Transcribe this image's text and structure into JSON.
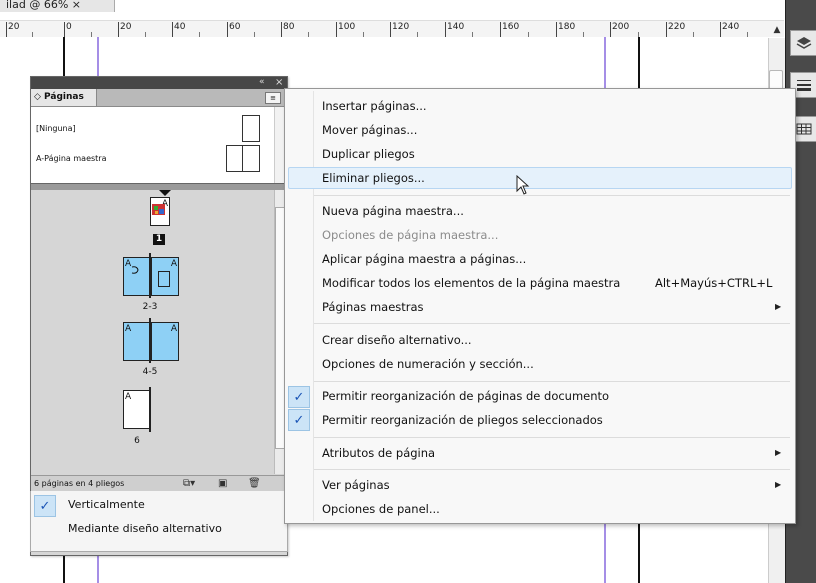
{
  "doc_tab": {
    "title": "ilad @ 66% ×"
  },
  "ruler": {
    "labels": [
      "20",
      "0",
      "20",
      "40",
      "60",
      "80",
      "100",
      "120",
      "140",
      "160",
      "180",
      "200",
      "220",
      "240"
    ]
  },
  "pages_panel": {
    "tab_label": "◇ Páginas",
    "collapse_glyph": "«",
    "close_glyph": "×",
    "menu_glyph": "≡",
    "masters": [
      {
        "label": "[Ninguna]"
      },
      {
        "label": "A-Página maestra"
      }
    ],
    "pages": [
      {
        "master": "A",
        "number": "1"
      },
      {
        "left_master": "A",
        "right_master": "A",
        "label": "2-3"
      },
      {
        "left_master": "A",
        "right_master": "A",
        "label": "4-5"
      },
      {
        "master": "A",
        "label": "6"
      }
    ],
    "footer": {
      "count": "6 páginas en 4 pliegos"
    }
  },
  "submenu": {
    "items": [
      {
        "label": "Verticalmente",
        "checked": true
      },
      {
        "label": "Mediante diseño alternativo",
        "checked": false
      }
    ]
  },
  "context_menu": {
    "items": [
      {
        "label": "Insertar páginas..."
      },
      {
        "label": "Mover páginas..."
      },
      {
        "label": "Duplicar pliegos"
      },
      {
        "label": "Eliminar pliegos...",
        "hover": true
      },
      {
        "label": "Nueva página maestra..."
      },
      {
        "label": "Opciones de página maestra...",
        "disabled": true
      },
      {
        "label": "Aplicar página maestra a páginas..."
      },
      {
        "label": "Modificar todos los elementos de la página maestra",
        "shortcut": "Alt+Mayús+CTRL+L"
      },
      {
        "label": "Páginas maestras",
        "submenu": true
      },
      {
        "label": "Crear diseño alternativo..."
      },
      {
        "label": "Opciones de numeración y sección..."
      },
      {
        "label": "Permitir reorganización de páginas de documento",
        "checked": true
      },
      {
        "label": "Permitir reorganización de pliegos seleccionados",
        "checked": true
      },
      {
        "label": "Atributos de página",
        "submenu": true
      },
      {
        "label": "Ver páginas",
        "submenu": true
      },
      {
        "label": "Opciones de panel..."
      }
    ],
    "check_glyph": "✓",
    "submenu_arrow": "▶"
  }
}
